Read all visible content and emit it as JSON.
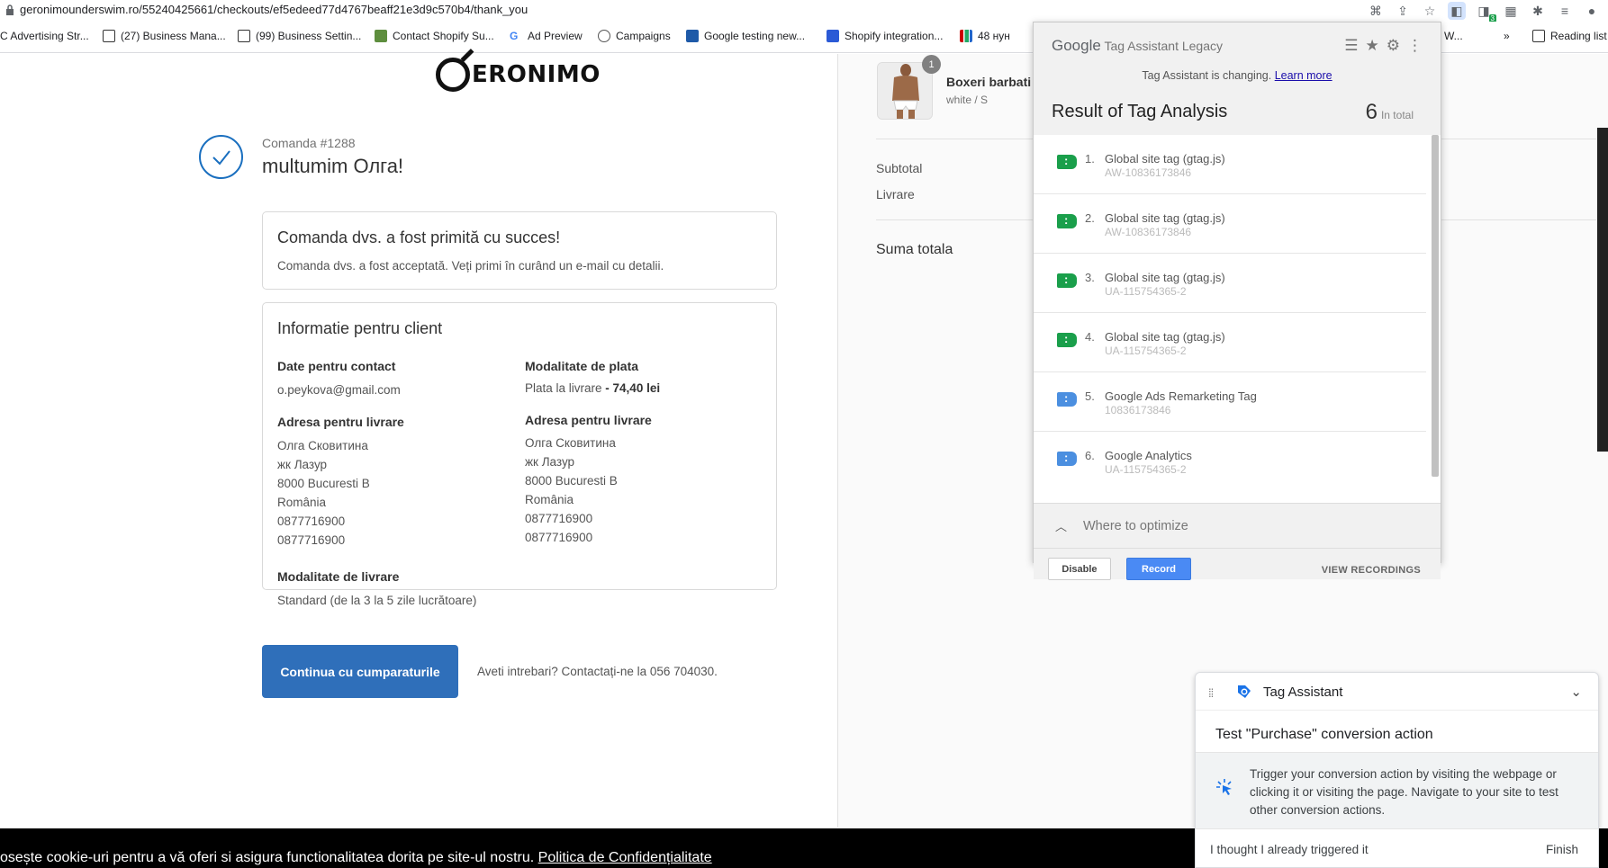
{
  "browser": {
    "url": "geronimounderswim.ro/55240425661/checkouts/ef5edeed77d4767beaff21e3d9c570b4/thank_you",
    "bookmarks": [
      "C Advertising Str...",
      "(27) Business Mana...",
      "(99) Business Settin...",
      "Contact Shopify Su...",
      "Ad Preview",
      "Campaigns",
      "Google testing new...",
      "Shopify integration...",
      "48 нун",
      "e W...",
      "»",
      "Reading list"
    ],
    "extension_badge": "3"
  },
  "page": {
    "logo_text": "ERONIMO",
    "order_number": "Comanda #1288",
    "thank_you": "multumim Олга!",
    "confirm_box": {
      "title": "Comanda dvs. a fost primită cu succes!",
      "text": "Comanda dvs. a fost acceptată. Veți primi în curând un e-mail cu detalii."
    },
    "customer_info": {
      "title": "Informatie pentru client",
      "contact_heading": "Date pentru contact",
      "contact_email": "o.peykova@gmail.com",
      "payment_heading": "Modalitate de plata",
      "payment_method": "Plata la livrare",
      "payment_amount": " - 74,40 lei",
      "shipping_address_heading": "Adresa pentru livrare",
      "shipping_address_lines": [
        "Олга Сковитина",
        "жк Лазур",
        "8000 Bucuresti B",
        "România",
        "0877716900",
        "0877716900"
      ],
      "billing_address_heading": "Adresa pentru livrare",
      "billing_address_lines": [
        "Олга Сковитина",
        "жк Лазур",
        "8000 Bucuresti B",
        "România",
        "0877716900",
        "0877716900"
      ],
      "shipping_method_heading": "Modalitate de livrare",
      "shipping_method": "Standard (de la 3 la 5 zile lucrătoare)"
    },
    "continue_button": "Continua cu cumparaturile",
    "help_text": "Aveti intrebari? Contactați-ne la 056 704030."
  },
  "summary": {
    "product_name": "Boxeri barbati n",
    "product_variant": "white / S",
    "product_qty": "1",
    "subtotal_label": "Subtotal",
    "shipping_label": "Livrare",
    "total_label": "Suma totala"
  },
  "cookie_bar": {
    "text": "osește cookie-uri pentru a vă oferi si asigura functionalitatea dorita pe site-ul nostru. ",
    "link": "Politica de Confidențialitate"
  },
  "tag_assistant_legacy": {
    "brand_google": "Google",
    "brand_product": " Tag Assistant Legacy",
    "changing_text": "Tag Assistant is changing. ",
    "learn_more": "Learn more",
    "title": "Result of Tag Analysis",
    "total_count": "6",
    "total_label": "In total",
    "tags": [
      {
        "num": "1.",
        "name": "Global site tag (gtag.js)",
        "id": "AW-10836173846",
        "color": "#1a9f4b"
      },
      {
        "num": "2.",
        "name": "Global site tag (gtag.js)",
        "id": "AW-10836173846",
        "color": "#1a9f4b"
      },
      {
        "num": "3.",
        "name": "Global site tag (gtag.js)",
        "id": "UA-115754365-2",
        "color": "#1a9f4b"
      },
      {
        "num": "4.",
        "name": "Global site tag (gtag.js)",
        "id": "UA-115754365-2",
        "color": "#1a9f4b"
      },
      {
        "num": "5.",
        "name": "Google Ads Remarketing Tag",
        "id": "10836173846",
        "color": "#4b8fe0"
      },
      {
        "num": "6.",
        "name": "Google Analytics",
        "id": "UA-115754365-2",
        "color": "#4b8fe0"
      }
    ],
    "where_to_optimize": "Where to optimize",
    "disable_button": "Disable",
    "record_button": "Record",
    "view_recordings": "VIEW RECORDINGS"
  },
  "tag_assistant_panel": {
    "title": "Tag Assistant",
    "subtitle": "Test \"Purchase\" conversion action",
    "instructions": "Trigger your conversion action by visiting the webpage or clicking it or visiting the page. Navigate to your site to test other conversion actions.",
    "already_triggered": "I thought I already triggered it",
    "finish": "Finish"
  },
  "colors": {
    "primary_button": "#2f6fba",
    "check_circle": "#1a6fbf",
    "tag_green": "#1a9f4b",
    "tag_blue": "#4b8fe0",
    "record_blue": "#4a8af4"
  }
}
